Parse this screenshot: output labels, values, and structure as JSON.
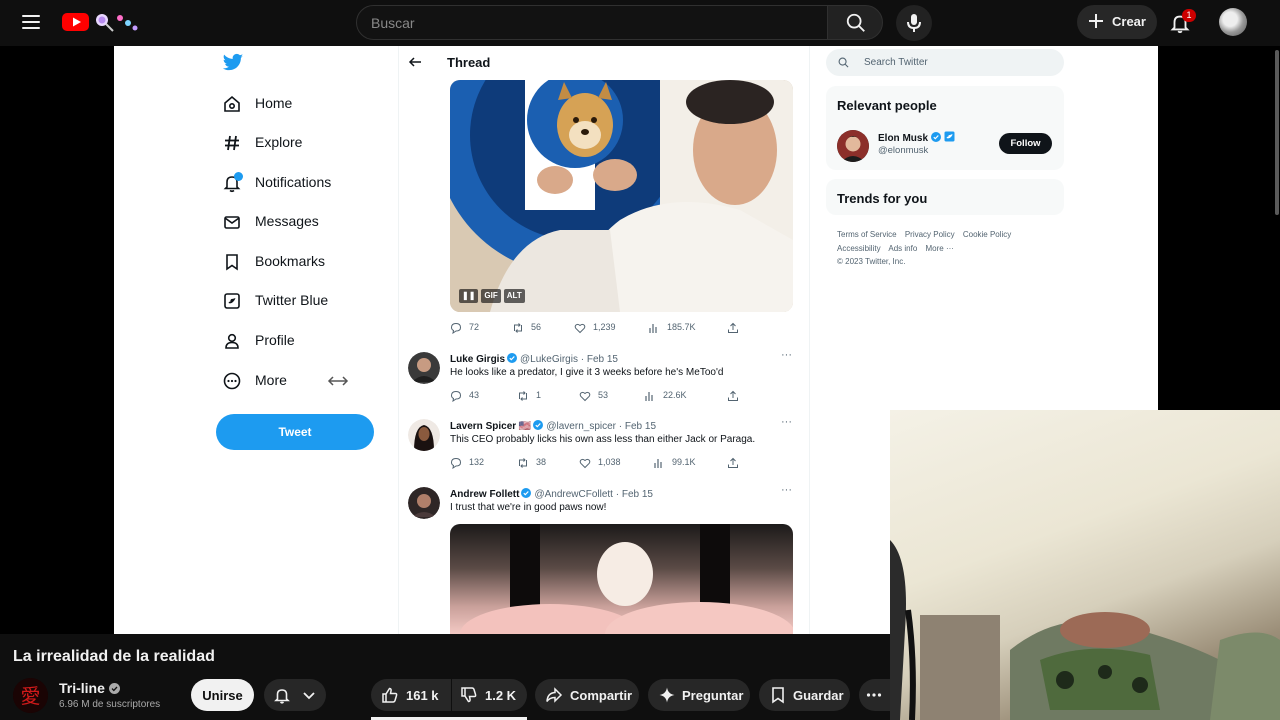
{
  "youtube": {
    "search_placeholder": "Buscar",
    "create_label": "Crear",
    "notifications_count": "1",
    "video_title": "La irrealidad de la realidad",
    "channel_name": "Tri-line",
    "channel_subscribers": "6.96 M de suscriptores",
    "join_label": "Unirse",
    "likes": "161 k",
    "dislikes": "1.2 K",
    "share_label": "Compartir",
    "ask_label": "Preguntar",
    "save_label": "Guardar"
  },
  "twitter": {
    "nav": [
      {
        "label": "Home",
        "icon": "home-icon"
      },
      {
        "label": "Explore",
        "icon": "hashtag-icon"
      },
      {
        "label": "Notifications",
        "icon": "bell-icon"
      },
      {
        "label": "Messages",
        "icon": "envelope-icon"
      },
      {
        "label": "Bookmarks",
        "icon": "bookmark-icon"
      },
      {
        "label": "Twitter Blue",
        "icon": "twitter-blue-icon"
      },
      {
        "label": "Profile",
        "icon": "person-icon"
      },
      {
        "label": "More",
        "icon": "more-circle-icon"
      }
    ],
    "tweet_button": "Tweet",
    "thread_title": "Thread",
    "media_badges": [
      "GIF",
      "ALT"
    ],
    "main_stats": {
      "replies": "72",
      "retweets": "56",
      "likes": "1,239",
      "views": "185.7K"
    },
    "replies": [
      {
        "name": "Luke Girgis",
        "handle": "@LukeGirgis · Feb 15",
        "text": "He looks like a predator, I give it 3 weeks before he's MeToo'd",
        "stats": {
          "replies": "43",
          "retweets": "1",
          "likes": "53",
          "views": "22.6K"
        }
      },
      {
        "name": "Lavern Spicer 🇺🇸",
        "handle": "@lavern_spicer · Feb 15",
        "text": "This CEO probably licks his own ass less than either Jack or Paraga.",
        "stats": {
          "replies": "132",
          "retweets": "38",
          "likes": "1,038",
          "views": "99.1K"
        }
      },
      {
        "name": "Andrew Follett",
        "handle": "@AndrewCFollett · Feb 15",
        "text": "I trust that we're in good paws now!"
      }
    ],
    "search_placeholder": "Search Twitter",
    "relevant_people_heading": "Relevant people",
    "person": {
      "name": "Elon Musk",
      "handle": "@elonmusk",
      "follow_label": "Follow"
    },
    "trends_heading": "Trends for you",
    "footer_links": [
      "Terms of Service",
      "Privacy Policy",
      "Cookie Policy",
      "Accessibility",
      "Ads info",
      "More ···",
      "© 2023 Twitter, Inc."
    ]
  },
  "colors": {
    "twitter_blue": "#1d9bf0",
    "youtube_red": "#ff0000",
    "dark_bg": "#0f0f0f"
  }
}
